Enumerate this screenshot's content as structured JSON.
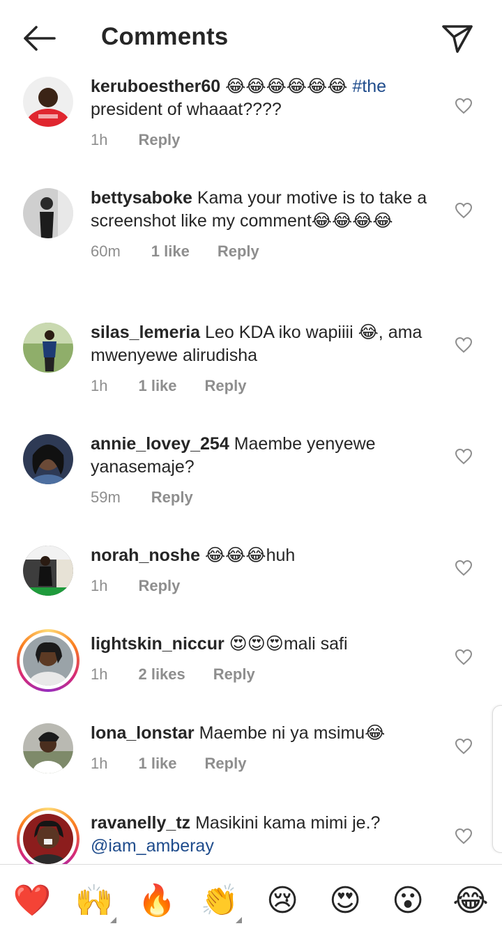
{
  "header": {
    "title": "Comments"
  },
  "comments": [
    {
      "username": "keruboesther60",
      "text": "😂😂😂😂😂😂",
      "hashtag": "#the",
      "text_after": "president of whaaat????",
      "time": "1h",
      "likes": "",
      "reply": "Reply"
    },
    {
      "username": "bettysaboke",
      "text": "Kama your motive is to take a screenshot like my comment😂😂😂😂",
      "time": "60m",
      "likes": "1 like",
      "reply": "Reply"
    },
    {
      "username": "silas_lemeria",
      "text": "Leo KDA iko wapiiii 😂, ama mwenyewe alirudisha",
      "time": "1h",
      "likes": "1 like",
      "reply": "Reply"
    },
    {
      "username": "annie_lovey_254",
      "text": "Maembe yenyewe yanasemaje?",
      "time": "59m",
      "likes": "",
      "reply": "Reply"
    },
    {
      "username": "norah_noshe",
      "text": "😂😂😂huh",
      "time": "1h",
      "likes": "",
      "reply": "Reply"
    },
    {
      "username": "lightskin_niccur",
      "text": "😍😍😍mali safi",
      "time": "1h",
      "likes": "2 likes",
      "reply": "Reply"
    },
    {
      "username": "lona_lonstar",
      "text": "Maembe ni ya msimu😂",
      "time": "1h",
      "likes": "1 like",
      "reply": "Reply"
    },
    {
      "username": "ravanelly_tz",
      "text": "Masikini kama mimi je.?",
      "mention": "@iam_amberay",
      "time": "",
      "likes": "",
      "reply": ""
    }
  ],
  "reactions": [
    "❤️",
    "🙌",
    "🔥",
    "👏",
    "😢",
    "😍",
    "😮",
    "😂"
  ],
  "colors": {
    "text": "#262626",
    "meta": "#8e8e8e",
    "link": "#1f4c8c",
    "heart_reaction": "#ed1c24"
  }
}
